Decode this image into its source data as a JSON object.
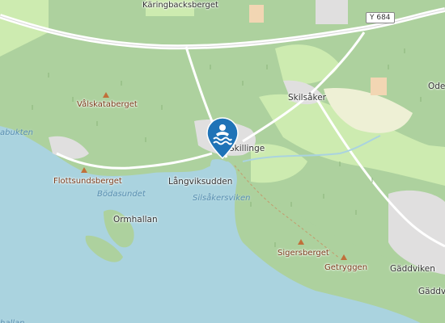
{
  "map": {
    "road_badge": "Y 684",
    "labels": {
      "karingbacksberget": "Käringbacksberget",
      "valskataberget": "Vålskataberget",
      "skilsaker": "Skilsåker",
      "skillinge": "Skillinge",
      "langviksudden": "Långviksudden",
      "flottsundsberget": "Flottsundsberget",
      "bodasundet": "Bödasundet",
      "ormhallan": "Ormhallan",
      "silsakersviken": "Silsåkersviken",
      "sigersberget": "Sigersberget",
      "getryggen": "Getryggen",
      "gaddviken": "Gäddviken",
      "gaddvi_edge": "Gäddvi",
      "abukten": "abukten",
      "ode_edge": "Ode",
      "hallan": "hallan"
    },
    "marker_icon": "swimming-icon",
    "colors": {
      "water": "#aad3df",
      "forest": "#add19e",
      "field": "#cdebb0",
      "pin": "#1f73b7"
    }
  }
}
